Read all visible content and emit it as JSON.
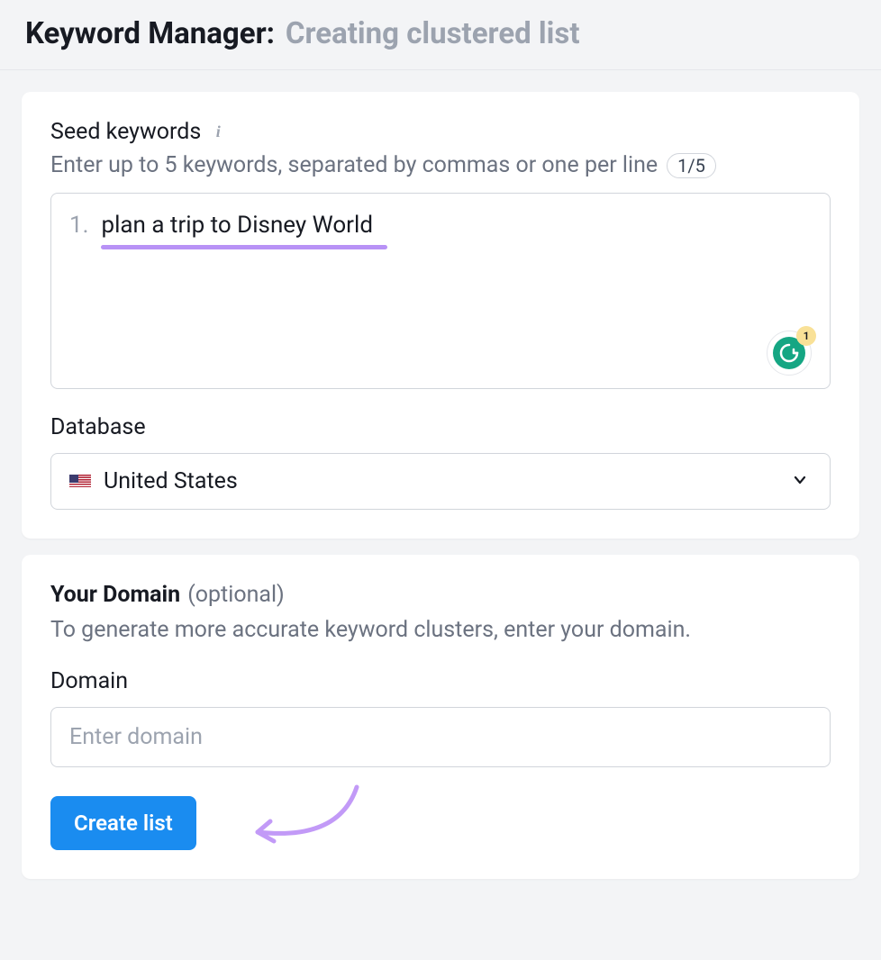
{
  "header": {
    "title": "Keyword Manager:",
    "subtitle": "Creating clustered list"
  },
  "seed": {
    "label": "Seed keywords",
    "helper": "Enter up to 5 keywords, separated by commas or one per line",
    "count": "1/5",
    "items": [
      {
        "num": "1.",
        "text": "plan a trip to Disney World"
      }
    ]
  },
  "grammarly": {
    "notif": "1"
  },
  "database": {
    "label": "Database",
    "selected": "United States"
  },
  "domain": {
    "title": "Your Domain",
    "optional": "(optional)",
    "helper": "To generate more accurate keyword clusters, enter your domain.",
    "label": "Domain",
    "placeholder": "Enter domain"
  },
  "actions": {
    "create_label": "Create list"
  }
}
